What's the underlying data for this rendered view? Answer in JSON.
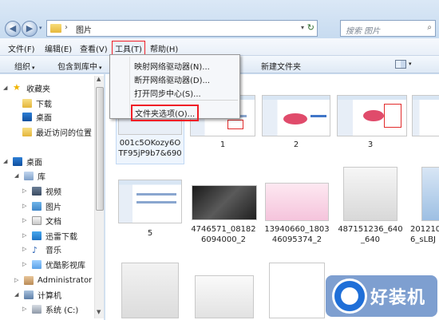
{
  "window": {
    "address_sep": "›",
    "address_path": "图片",
    "address_drop": "▾",
    "refresh_glyph": "↻",
    "search_placeholder": "搜索 图片",
    "search_icon": "⌕",
    "back_glyph": "◀",
    "forward_glyph": "▶"
  },
  "menubar": {
    "file": "文件(F)",
    "edit": "编辑(E)",
    "view": "查看(V)",
    "tools": "工具(T)",
    "help": "帮助(H)"
  },
  "cmdbar": {
    "organize": "组织",
    "include": "包含到库中",
    "new_folder": "新建文件夹",
    "arrow": "▾"
  },
  "tools_menu": {
    "items": [
      "映射网络驱动器(N)...",
      "断开网络驱动器(D)...",
      "打开同步中心(S)...",
      "文件夹选项(O)..."
    ]
  },
  "nav_pane": {
    "favorites": "收藏夹",
    "downloads": "下载",
    "desktop": "桌面",
    "recent": "最近访问的位置",
    "desktop_root": "桌面",
    "libraries": "库",
    "videos": "视频",
    "pictures": "图片",
    "documents": "文档",
    "xunlei": "迅雷下载",
    "music": "音乐",
    "youku": "优酷影视库",
    "admin": "Administrator",
    "computer": "计算机",
    "system_c": "系统 (C:)",
    "star_glyph": "★",
    "music_glyph": "♪",
    "collapse_glyph": "◢",
    "expand_glyph": "▷",
    "scroll_up": "▲",
    "scroll_down": "▼"
  },
  "files": {
    "row1": [
      "001c5OKozy6OTF95jP9b7&690",
      "1",
      "2",
      "3"
    ],
    "row2": [
      "5",
      "4746571_081826094000_2",
      "13940660_180346095374_2",
      "487151236_640_640",
      "201210_sLBJ"
    ],
    "row2_lines": [
      [
        "5"
      ],
      [
        "4746571_08182",
        "6094000_2"
      ],
      [
        "13940660_1803",
        "46095374_2"
      ],
      [
        "487151236_640",
        "_640"
      ],
      [
        "201210",
        "6_sLBJ"
      ]
    ],
    "row1_lines": [
      [
        "001c5OKozy6O",
        "TF95jP9b7&690"
      ],
      [
        "1"
      ],
      [
        "2"
      ],
      [
        "3"
      ]
    ]
  },
  "watermark": {
    "text": "好装机"
  },
  "colors": {
    "highlight_red": "#f01e26",
    "selection_blue": "#c1d8f4"
  }
}
